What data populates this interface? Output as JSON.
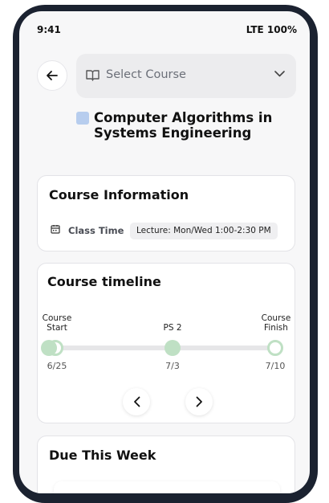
{
  "status_bar": {
    "time": "9:41",
    "network": "LTE 100%"
  },
  "header": {
    "course_select_placeholder": "Select Course"
  },
  "course": {
    "title": "Computer Algorithms in Systems Engineering",
    "color": "#b7cdee"
  },
  "course_info": {
    "title": "Course Information",
    "class_time_label": "Class Time",
    "class_time_value": "Lecture: Mon/Wed 1:00-2:30 PM"
  },
  "timeline": {
    "title": "Course timeline",
    "milestones": [
      {
        "label": "Course Start",
        "date": "6/25",
        "status": "done"
      },
      {
        "label": "PS 2",
        "date": "7/3",
        "status": "done"
      },
      {
        "label": "Course Finish",
        "date": "7/10",
        "status": "upcoming"
      }
    ],
    "accent": "#bfe0c4"
  },
  "due": {
    "title": "Due This Week"
  }
}
